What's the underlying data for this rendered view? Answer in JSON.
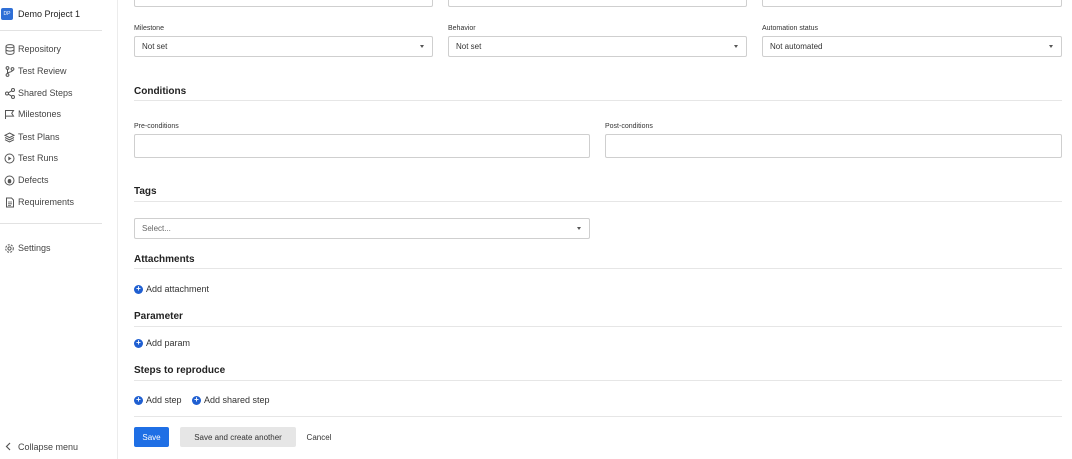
{
  "sidebar": {
    "project_badge": "DP",
    "project_name": "Demo Project 1",
    "items": [
      {
        "label": "Repository",
        "icon": "database-icon"
      },
      {
        "label": "Test Review",
        "icon": "git-branch-icon"
      },
      {
        "label": "Shared Steps",
        "icon": "share-icon"
      },
      {
        "label": "Milestones",
        "icon": "flag-icon"
      },
      {
        "label": "Test Plans",
        "icon": "layers-icon"
      },
      {
        "label": "Test Runs",
        "icon": "play-circle-icon"
      },
      {
        "label": "Defects",
        "icon": "bug-icon"
      },
      {
        "label": "Requirements",
        "icon": "document-icon"
      }
    ],
    "settings_label": "Settings",
    "collapse_label": "Collapse menu"
  },
  "top_row": {
    "field1_value": "",
    "field2_value": "",
    "field3_value": ""
  },
  "fields": {
    "milestone": {
      "label": "Milestone",
      "value": "Not set"
    },
    "behavior": {
      "label": "Behavior",
      "value": "Not set"
    },
    "automation": {
      "label": "Automation status",
      "value": "Not automated"
    }
  },
  "conditions": {
    "title": "Conditions",
    "pre_label": "Pre-conditions",
    "post_label": "Post-conditions"
  },
  "tags": {
    "title": "Tags",
    "placeholder": "Select..."
  },
  "attachments": {
    "title": "Attachments",
    "add_label": "Add attachment"
  },
  "parameter": {
    "title": "Parameter",
    "add_label": "Add param"
  },
  "steps": {
    "title": "Steps to reproduce",
    "add_step_label": "Add step",
    "add_shared_label": "Add shared step"
  },
  "actions": {
    "save": "Save",
    "save_another": "Save and create another",
    "cancel": "Cancel"
  },
  "colors": {
    "primary": "#1f6fe5",
    "link_icon": "#1f5fd1"
  }
}
